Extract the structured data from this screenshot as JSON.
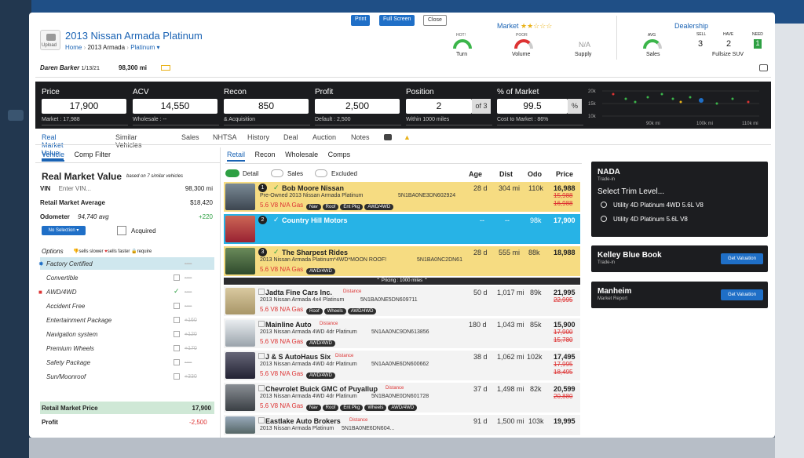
{
  "header": {
    "print": "Print",
    "fullscreen": "Full Screen",
    "close": "Close",
    "upload": "Upload",
    "title": "2013 Nissan Armada Platinum",
    "breadcrumb_home": "Home",
    "breadcrumb_model": "2013 Armada",
    "trim": "Platinum",
    "user": "Daren Barker",
    "date": "1/13/21",
    "miles": "98,300 mi"
  },
  "market": {
    "title": "Market",
    "stars": "★★☆☆☆",
    "hot": "HOT!",
    "turn": "Turn",
    "poor": "POOR",
    "volume": "Volume",
    "na": "N/A",
    "supply": "Supply"
  },
  "dealership": {
    "title": "Dealership",
    "avg": "AVG",
    "sales": "Sales",
    "sell_lbl": "SELL",
    "sell": "3",
    "have_lbl": "HAVE",
    "have": "2",
    "need_lbl": "NEED",
    "need": "1",
    "segment": "Fullsize SUV"
  },
  "metrics": [
    {
      "label": "Price",
      "value": "17,900",
      "sub": "Market : 17,988"
    },
    {
      "label": "ACV",
      "value": "14,550",
      "sub": "Wholesale : --"
    },
    {
      "label": "Recon",
      "value": "850",
      "sub": "& Acquisition"
    },
    {
      "label": "Profit",
      "value": "2,500",
      "sub": "Default : 2,500"
    },
    {
      "label": "Position",
      "value": "2",
      "of": "of 3",
      "sub": "Within 1000 miles"
    },
    {
      "label": "% of Market",
      "value": "99.5",
      "pct": "%",
      "sub": "Cost to Market : 86%"
    }
  ],
  "chart_axis": {
    "y": [
      "20k",
      "15k",
      "10k"
    ],
    "x": [
      "90k mi",
      "100k mi",
      "110k mi"
    ]
  },
  "tabs": [
    "Real Market Value",
    "Similar Vehicles",
    "Sales",
    "NHTSA",
    "History",
    "Deal",
    "Auction",
    "Notes"
  ],
  "subtabs_left": [
    "Vehicle",
    "Comp Filter"
  ],
  "subtabs_right": [
    "Retail",
    "Recon",
    "Wholesale",
    "Comps"
  ],
  "rmv": {
    "title": "Real Market Value",
    "note": "based on 7 similar vehicles",
    "vin_lbl": "VIN",
    "vin_ph": "Enter VIN...",
    "vin_miles": "98,300 mi",
    "avg_lbl": "Retail Market Average",
    "avg": "$18,420",
    "odo_lbl": "Odometer",
    "odo": "94,740 avg",
    "odo_diff": "+220",
    "noselect": "No Selection ▾",
    "acquired": "Acquired",
    "options": "Options",
    "slower": "sells slower",
    "faster": "sells faster",
    "require": "require",
    "rmp_lbl": "Retail Market Price",
    "rmp": "17,900",
    "profit_lbl": "Profit",
    "profit": "-2,500"
  },
  "options": [
    {
      "name": "Factory Certified",
      "val": "----"
    },
    {
      "name": "Convertible",
      "val": "----"
    },
    {
      "name": "AWD/4WD",
      "val": "----"
    },
    {
      "name": "Accident Free",
      "val": "----"
    },
    {
      "name": "Entertainment Package",
      "val": "+160"
    },
    {
      "name": "Navigation system",
      "val": "+120"
    },
    {
      "name": "Premium Wheels",
      "val": "+170"
    },
    {
      "name": "Safety Package",
      "val": "----"
    },
    {
      "name": "Sun/Moonroof",
      "val": "+330"
    }
  ],
  "filters": {
    "detail": "Detail",
    "sales": "Sales",
    "excluded": "Excluded"
  },
  "cols": {
    "age": "Age",
    "dist": "Dist",
    "odo": "Odo",
    "price": "Price"
  },
  "pricing_note": "⌃ Pricing : 1000 miles ⌃",
  "listings": [
    {
      "n": "1",
      "name": "Bob Moore Nissan",
      "desc": "Pre-Owned 2013 Nissan Armada Platinum",
      "vin": "5N1BA0NE3DN602924",
      "eng": "5.6 V8 N/A Gas",
      "badges": [
        "Nav",
        "Roof",
        "Ent Pkg",
        "AWD/4WD"
      ],
      "age": "28 d",
      "dist": "304 mi",
      "odo": "110k",
      "price": "16,988",
      "old": [
        "15,988",
        "16,988"
      ]
    },
    {
      "n": "2",
      "name": "Country Hill Motors",
      "age": "--",
      "dist": "--",
      "odo": "98k",
      "price": "17,900"
    },
    {
      "n": "3",
      "name": "The Sharpest Rides",
      "desc": "2013 Nissan Armada Platinum*4WD*MOON ROOF!",
      "vin": "5N1BA0NC2DN61",
      "eng": "5.6 V8 N/A Gas",
      "badges": [
        "AWD/4WD"
      ],
      "age": "28 d",
      "dist": "555 mi",
      "odo": "88k",
      "price": "18,988"
    },
    {
      "name": "Jadta Fine Cars Inc.",
      "tag": "Distance",
      "desc": "2013 Nissan Armada 4x4 Platinum",
      "vin": "5N1BA0NE5DN609711",
      "eng": "5.6 V8 N/A Gas",
      "badges": [
        "Roof",
        "Wheels",
        "AWD/4WD"
      ],
      "age": "50 d",
      "dist": "1,017 mi",
      "odo": "89k",
      "price": "21,995",
      "old": [
        "22,995"
      ]
    },
    {
      "name": "Mainline Auto",
      "tag": "Distance",
      "desc": "2013 Nissan Armada 4WD 4dr Platinum",
      "vin": "5N1AA0NC9DN613856",
      "eng": "5.6 V8 N/A Gas",
      "badges": [
        "AWD/4WD"
      ],
      "age": "180 d",
      "dist": "1,043 mi",
      "odo": "85k",
      "price": "15,900",
      "old": [
        "17,900",
        "15,780"
      ]
    },
    {
      "name": "J & S AutoHaus Six",
      "tag": "Distance",
      "desc": "2013 Nissan Armada 4WD 4dr Platinum",
      "vin": "5N1AA0NE6DN600662",
      "eng": "5.6 V8 N/A Gas",
      "badges": [
        "AWD/4WD"
      ],
      "age": "38 d",
      "dist": "1,062 mi",
      "odo": "102k",
      "price": "17,495",
      "old": [
        "17,995",
        "18,495"
      ]
    },
    {
      "name": "Chevrolet Buick GMC of Puyallup",
      "tag": "Distance",
      "desc": "2013 Nissan Armada 4WD 4dr Platinum",
      "vin": "5N1BA0NE0DN601728",
      "eng": "5.6 V8 N/A Gas",
      "badges": [
        "Nav",
        "Roof",
        "Ent Pkg",
        "Wheels",
        "AWD/4WD"
      ],
      "age": "37 d",
      "dist": "1,498 mi",
      "odo": "82k",
      "price": "20,599",
      "old": [
        "20,880"
      ]
    },
    {
      "name": "Eastlake Auto Brokers",
      "tag": "Distance",
      "desc": "2013 Nissan Armada Platinum",
      "vin": "5N1BA0NE6DN604...",
      "age": "91 d",
      "dist": "1,500 mi",
      "odo": "103k",
      "price": "19,995"
    }
  ],
  "nada": {
    "title": "NADA",
    "sub": "Trade-in",
    "select": "Select Trim Level...",
    "opt1": "Utility 4D Platinum 4WD 5.6L V8",
    "opt2": "Utility 4D Platinum 5.6L V8"
  },
  "kbb": {
    "title": "Kelley Blue Book",
    "sub": "Trade-in",
    "btn": "Get Valuation"
  },
  "manheim": {
    "title": "Manheim",
    "sub": "Market Report",
    "btn": "Get Valuation"
  }
}
